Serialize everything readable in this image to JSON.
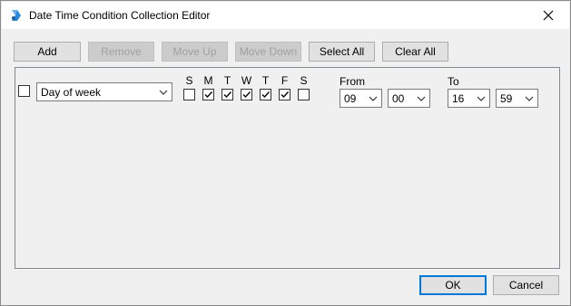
{
  "window": {
    "title": "Date Time Condition Collection Editor"
  },
  "toolbar": {
    "add_label": "Add",
    "remove_label": "Remove",
    "move_up_label": "Move Up",
    "move_down_label": "Move Down",
    "select_all_label": "Select All",
    "clear_all_label": "Clear All"
  },
  "condition": {
    "selected": false,
    "type_value": "Day of week",
    "days": [
      {
        "label": "S",
        "checked": false
      },
      {
        "label": "M",
        "checked": true
      },
      {
        "label": "T",
        "checked": true
      },
      {
        "label": "W",
        "checked": true
      },
      {
        "label": "T",
        "checked": true
      },
      {
        "label": "F",
        "checked": true
      },
      {
        "label": "S",
        "checked": false
      }
    ],
    "from_label": "From",
    "from_hour": "09",
    "from_minute": "00",
    "to_label": "To",
    "to_hour": "16",
    "to_minute": "59"
  },
  "footer": {
    "ok_label": "OK",
    "cancel_label": "Cancel"
  },
  "icons": {
    "app": "cube-arrow-icon",
    "close": "close-icon"
  }
}
